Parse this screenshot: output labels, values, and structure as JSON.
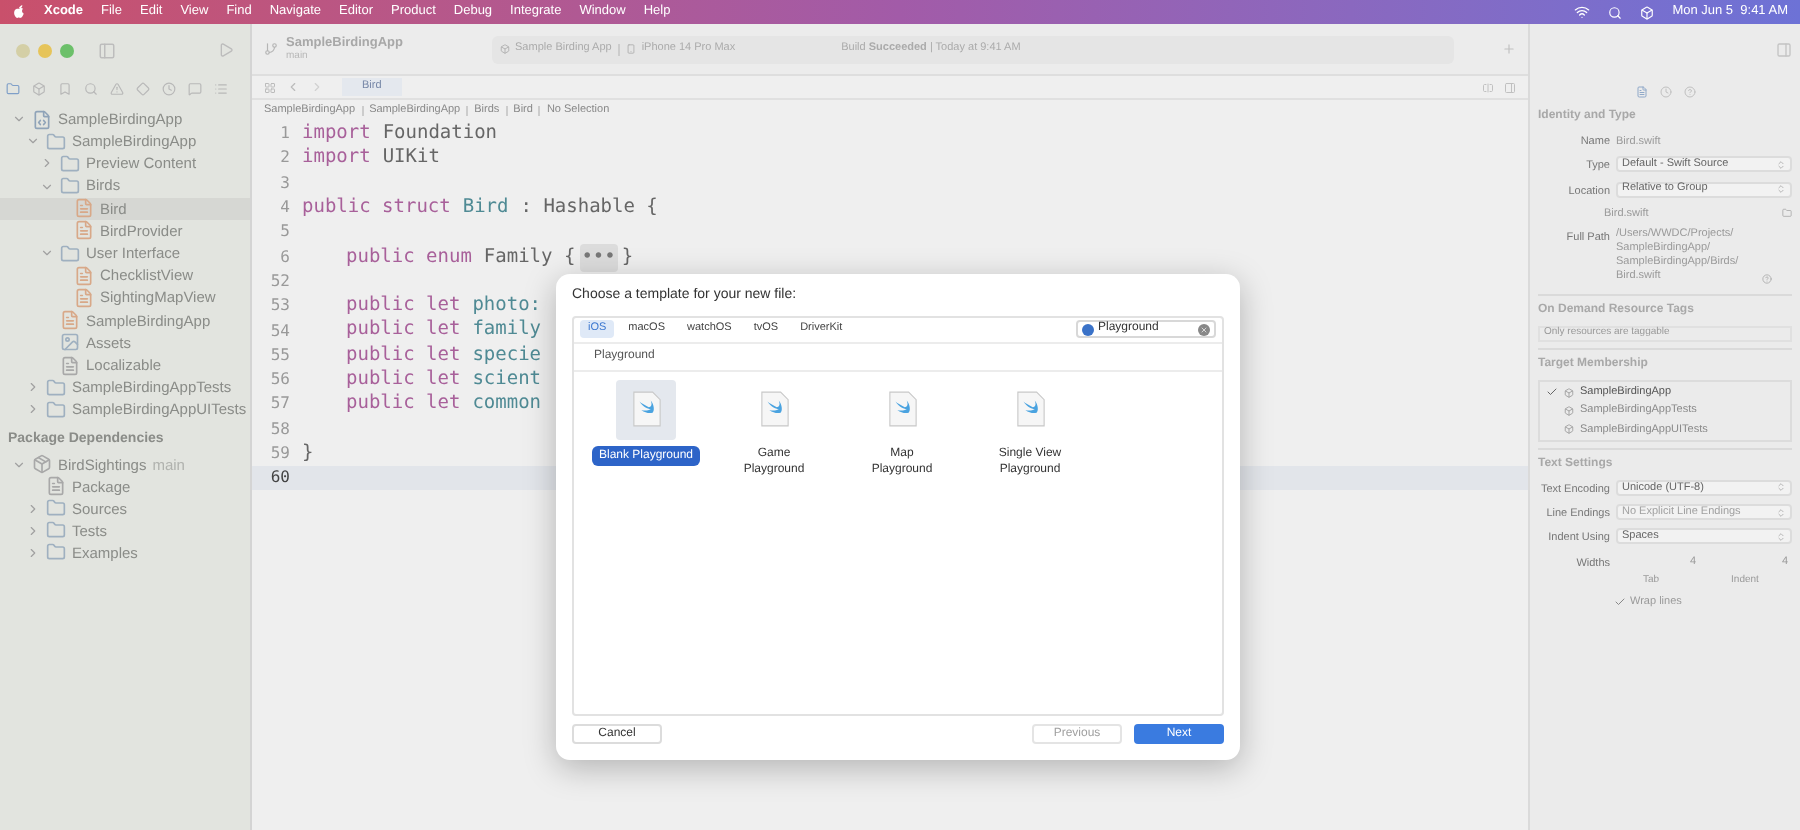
{
  "menu_bar": {
    "app": "Xcode",
    "items": [
      "File",
      "Edit",
      "View",
      "Find",
      "Navigate",
      "Editor",
      "Product",
      "Debug",
      "Integrate",
      "Window",
      "Help"
    ],
    "clock": "Mon Jun 5  9:41 AM"
  },
  "toolbar": {
    "project": "SampleBirdingApp",
    "branch": "main",
    "scheme": "Sample Birding App",
    "device": "iPhone 14 Pro Max",
    "status": "Build **Succeeded** | Today at 9:41 AM"
  },
  "navigator": {
    "tree": [
      {
        "label": "SampleBirdingApp",
        "kind": "project",
        "expanded": true,
        "selected": false,
        "children": [
          {
            "label": "SampleBirdingApp",
            "kind": "folder",
            "expanded": true,
            "selected": false,
            "children": [
              {
                "label": "Preview Content",
                "kind": "folder",
                "expanded": false,
                "selected": false
              },
              {
                "label": "Birds",
                "kind": "folder",
                "expanded": true,
                "selected": false,
                "children": [
                  {
                    "label": "Bird",
                    "kind": "swift",
                    "selected": true
                  },
                  {
                    "label": "BirdProvider",
                    "kind": "swift",
                    "selected": false
                  }
                ]
              },
              {
                "label": "User Interface",
                "kind": "folder",
                "expanded": true,
                "selected": false,
                "children": [
                  {
                    "label": "ChecklistView",
                    "kind": "swift",
                    "selected": false
                  },
                  {
                    "label": "SightingMapView",
                    "kind": "swift",
                    "selected": false
                  }
                ]
              },
              {
                "label": "SampleBirdingApp",
                "kind": "swift",
                "selected": false
              },
              {
                "label": "Assets",
                "kind": "assets",
                "selected": false
              },
              {
                "label": "Localizable",
                "kind": "file",
                "selected": false
              }
            ]
          },
          {
            "label": "SampleBirdingAppTests",
            "kind": "folder",
            "expanded": false,
            "selected": false
          },
          {
            "label": "SampleBirdingAppUITests",
            "kind": "folder",
            "expanded": false,
            "selected": false
          }
        ]
      }
    ],
    "packages_header": "Package Dependencies",
    "packages": [
      {
        "label": "BirdSightings",
        "branch": "main",
        "kind": "package",
        "expanded": true,
        "selected": false,
        "children": [
          {
            "label": "Package",
            "kind": "file",
            "selected": false
          },
          {
            "label": "Sources",
            "kind": "folder",
            "expanded": false,
            "selected": false
          },
          {
            "label": "Tests",
            "kind": "folder",
            "expanded": false,
            "selected": false
          },
          {
            "label": "Examples",
            "kind": "folder",
            "expanded": false,
            "selected": false
          }
        ]
      }
    ]
  },
  "editor": {
    "tab": "Bird",
    "breadcrumb": [
      "SampleBirdingApp",
      "SampleBirdingApp",
      "Birds",
      "Bird",
      "No Selection"
    ],
    "lines": [
      {
        "number": "1",
        "current": false,
        "indent": false,
        "tokens": [
          {
            "text": "import",
            "kind": "keyword"
          },
          {
            "text": "Foundation",
            "kind": "plain"
          }
        ]
      },
      {
        "number": "2",
        "current": false,
        "indent": false,
        "tokens": [
          {
            "text": "import",
            "kind": "keyword"
          },
          {
            "text": "UIKit",
            "kind": "plain"
          }
        ]
      },
      {
        "number": "3",
        "current": false
      },
      {
        "number": "4",
        "current": false,
        "indent": false,
        "tokens": [
          {
            "text": "public struct",
            "kind": "keyword"
          },
          {
            "text": "Bird",
            "kind": "type"
          },
          {
            "text": ": Hashable {",
            "kind": "plain"
          }
        ]
      },
      {
        "number": "5",
        "current": false
      },
      {
        "number": "6",
        "current": false,
        "indent": true,
        "tokens": [
          {
            "text": "public enum",
            "kind": "keyword"
          },
          {
            "text": "Family {",
            "kind": "plain"
          },
          {
            "text": "•••",
            "kind": "folded"
          },
          {
            "text": "}",
            "kind": "plain"
          }
        ]
      },
      {
        "number": "52",
        "current": false
      },
      {
        "number": "53",
        "current": false,
        "indent": true,
        "tokens": [
          {
            "text": "public let",
            "kind": "keyword"
          },
          {
            "text": "photo:",
            "kind": "type"
          }
        ]
      },
      {
        "number": "54",
        "current": false,
        "indent": true,
        "tokens": [
          {
            "text": "public let",
            "kind": "keyword"
          },
          {
            "text": "family",
            "kind": "type"
          }
        ]
      },
      {
        "number": "55",
        "current": false,
        "indent": true,
        "tokens": [
          {
            "text": "public let",
            "kind": "keyword"
          },
          {
            "text": "specie",
            "kind": "type"
          }
        ]
      },
      {
        "number": "56",
        "current": false,
        "indent": true,
        "tokens": [
          {
            "text": "public let",
            "kind": "keyword"
          },
          {
            "text": "scient",
            "kind": "type"
          }
        ]
      },
      {
        "number": "57",
        "current": false,
        "indent": true,
        "tokens": [
          {
            "text": "public let",
            "kind": "keyword"
          },
          {
            "text": "common",
            "kind": "type"
          }
        ]
      },
      {
        "number": "58",
        "current": false
      },
      {
        "number": "59",
        "current": false,
        "indent": false,
        "tokens": [
          {
            "text": "}",
            "kind": "plain"
          }
        ]
      },
      {
        "number": "60",
        "current": true
      }
    ]
  },
  "inspector": {
    "identity_header": "Identity and Type",
    "name_label": "Name",
    "name_value": "Bird.swift",
    "type_label": "Type",
    "type_value": "Default - Swift Source",
    "location_label": "Location",
    "location_value": "Relative to Group",
    "location_file": "Bird.swift",
    "full_path_label": "Full Path",
    "full_path_value": "/Users/WWDC/Projects/ SampleBirdingApp/ SampleBirdingApp/Birds/ Bird.swift",
    "tags_header": "On Demand Resource Tags",
    "tags_placeholder": "Only resources are taggable",
    "membership_header": "Target Membership",
    "targets": [
      {
        "label": "SampleBirdingApp",
        "checked": true
      },
      {
        "label": "SampleBirdingAppTests",
        "checked": false
      },
      {
        "label": "SampleBirdingAppUITests",
        "checked": false
      }
    ],
    "text_header": "Text Settings",
    "encoding_label": "Text Encoding",
    "encoding_value": "Unicode (UTF-8)",
    "endings_label": "Line Endings",
    "endings_value": "No Explicit Line Endings",
    "indent_label": "Indent Using",
    "indent_value": "Spaces",
    "widths_label": "Widths",
    "tab_value": "4",
    "tab_label": "Tab",
    "indent_width_value": "4",
    "indent_width_label": "Indent",
    "wrap_label": "Wrap lines",
    "wrap_checked": true
  },
  "dialog": {
    "title": "Choose a template for your new file:",
    "platforms": [
      {
        "label": "iOS",
        "selected": true
      },
      {
        "label": "macOS",
        "selected": false
      },
      {
        "label": "watchOS",
        "selected": false
      },
      {
        "label": "tvOS",
        "selected": false
      },
      {
        "label": "DriverKit",
        "selected": false
      }
    ],
    "search_value": "Playground",
    "section": "Playground",
    "templates": [
      {
        "label": "Blank Playground",
        "selected": true
      },
      {
        "label": "Game Playground",
        "selected": false
      },
      {
        "label": "Map Playground",
        "selected": false
      },
      {
        "label": "Single View Playground",
        "selected": false
      }
    ],
    "buttons": [
      {
        "label": "Cancel",
        "kind": "secondary",
        "disabled": false
      },
      {
        "label": "Previous",
        "kind": "secondary",
        "disabled": true
      },
      {
        "label": "Next",
        "kind": "primary",
        "disabled": false
      }
    ]
  }
}
